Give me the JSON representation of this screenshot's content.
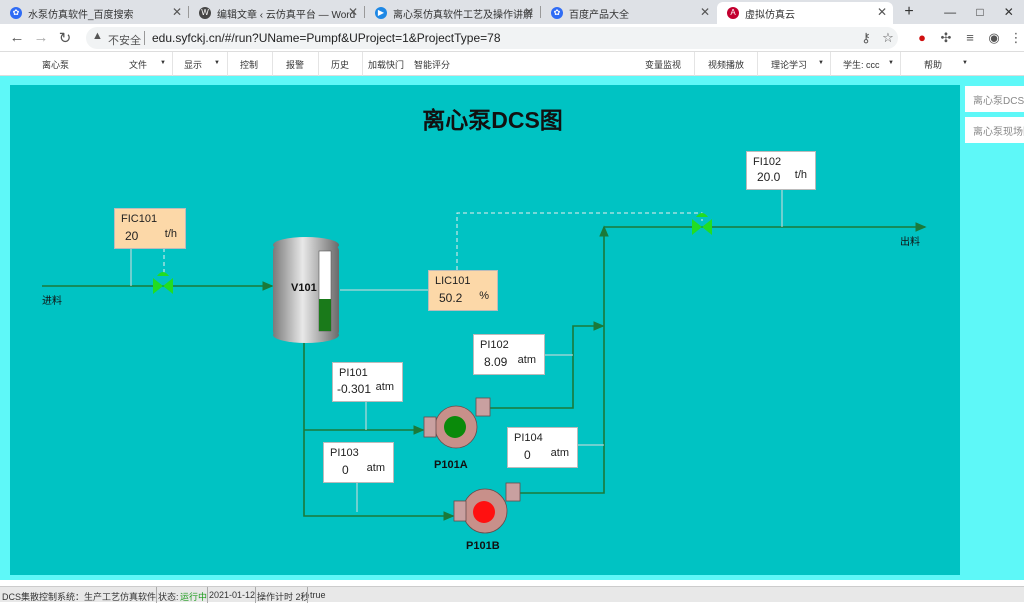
{
  "browser": {
    "tabs": [
      {
        "title": "水泵仿真软件_百度搜索",
        "icon": "baidu-icon"
      },
      {
        "title": "编辑文章 ‹ 云仿真平台 — Word",
        "icon": "wordpress-icon"
      },
      {
        "title": "离心泵仿真软件工艺及操作讲解",
        "icon": "video-icon"
      },
      {
        "title": "百度产品大全",
        "icon": "baidu-icon"
      },
      {
        "title": "虚拟仿真云",
        "icon": "app-icon"
      }
    ],
    "insecure_label": "不安全",
    "url": "edu.syfckj.cn/#/run?UName=Pumpf&UProject=1&ProjectType=78"
  },
  "menu": {
    "home": "离心泵",
    "file": "文件",
    "display": "显示",
    "control": "控制",
    "alarm": "报警",
    "history": "历史",
    "load_quick": "加载快门",
    "smart_score": "智能评分",
    "var_monitor": "变量监视",
    "video": "视频播放",
    "theory": "理论学习",
    "student": "学生: ccc",
    "help": "帮助"
  },
  "diagram": {
    "title": "离心泵DCS图",
    "inlet_label": "进料",
    "outlet_label": "出料",
    "vessel_label": "V101",
    "vessel_level": 0.4,
    "fic101": {
      "tag": "FIC101",
      "value": "20",
      "unit": "t/h"
    },
    "lic101": {
      "tag": "LIC101",
      "value": "50.2",
      "unit": "%"
    },
    "fi102": {
      "tag": "FI102",
      "value": "20.0",
      "unit": "t/h"
    },
    "pi101": {
      "tag": "PI101",
      "value": "-0.301",
      "unit": "atm"
    },
    "pi102": {
      "tag": "PI102",
      "value": "8.09",
      "unit": "atm"
    },
    "pi103": {
      "tag": "PI103",
      "value": "0",
      "unit": "atm"
    },
    "pi104": {
      "tag": "PI104",
      "value": "0",
      "unit": "atm"
    },
    "pump_a_label": "P101A",
    "pump_b_label": "P101B",
    "pump_a_color": "#0a8a0a",
    "pump_b_color": "#ff1010"
  },
  "side_panel": {
    "item1": "离心泵DCS",
    "item2": "离心泵现场图"
  },
  "status_bar": {
    "system": "DCS集散控制系统：生产工艺仿真软件",
    "state_label": "状态:",
    "state_value": "运行中",
    "date": "2021-01-12",
    "timer": "操作计时 2秒",
    "flag": "true"
  }
}
